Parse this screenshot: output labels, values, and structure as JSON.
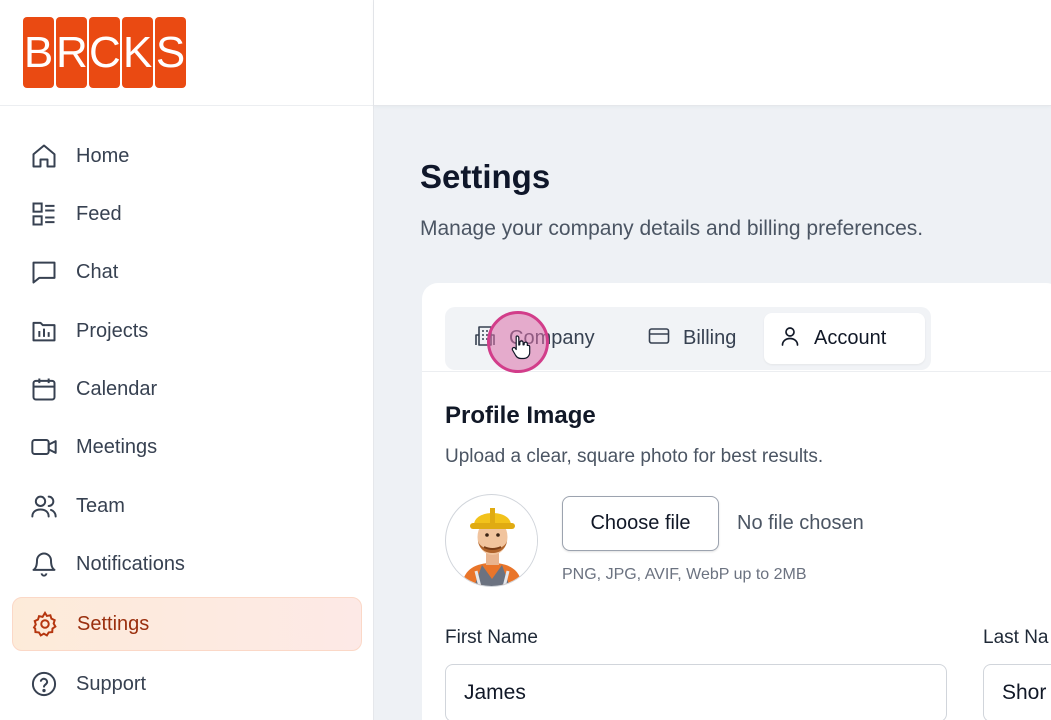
{
  "brand": {
    "letters": [
      "B",
      "R",
      "C",
      "K",
      "S"
    ],
    "color": "#ea4a12"
  },
  "sidebar": {
    "items": [
      {
        "label": "Home",
        "icon": "home-icon"
      },
      {
        "label": "Feed",
        "icon": "feed-icon"
      },
      {
        "label": "Chat",
        "icon": "chat-icon"
      },
      {
        "label": "Projects",
        "icon": "projects-icon"
      },
      {
        "label": "Calendar",
        "icon": "calendar-icon"
      },
      {
        "label": "Meetings",
        "icon": "video-icon"
      },
      {
        "label": "Team",
        "icon": "team-icon"
      },
      {
        "label": "Notifications",
        "icon": "bell-icon"
      },
      {
        "label": "Settings",
        "icon": "gear-icon",
        "active": true
      },
      {
        "label": "Support",
        "icon": "help-icon"
      }
    ]
  },
  "page": {
    "title": "Settings",
    "subtitle": "Manage your company details and billing preferences."
  },
  "tabs": [
    {
      "label": "Company",
      "icon": "building-icon"
    },
    {
      "label": "Billing",
      "icon": "credit-card-icon"
    },
    {
      "label": "Account",
      "icon": "user-icon",
      "active": true
    }
  ],
  "profile": {
    "title": "Profile Image",
    "description": "Upload a clear, square photo for best results.",
    "choose_label": "Choose file",
    "no_file": "No file chosen",
    "hint": "PNG, JPG, AVIF, WebP up to 2MB"
  },
  "form": {
    "first_name_label": "First Name",
    "first_name_value": "James",
    "last_name_label": "Last Na",
    "last_name_value": "Shor"
  }
}
